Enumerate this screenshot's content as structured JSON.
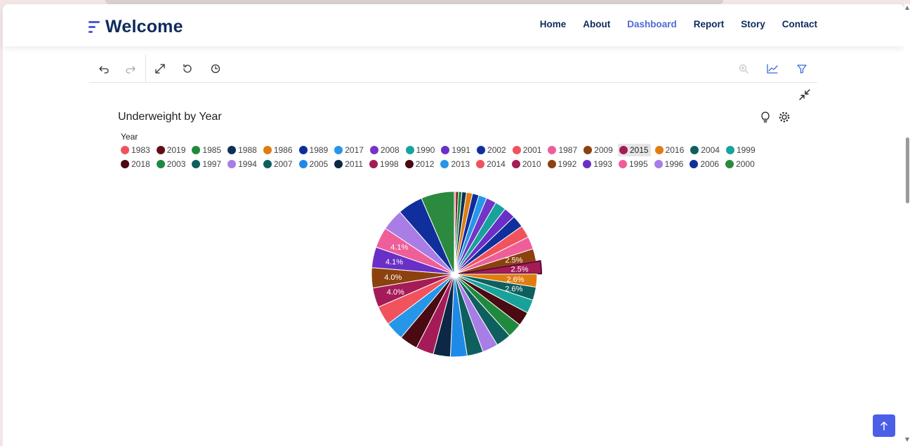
{
  "nav": {
    "brand": "Welcome",
    "links": [
      "Home",
      "About",
      "Dashboard",
      "Report",
      "Story",
      "Contact"
    ],
    "active": "Dashboard"
  },
  "toolbar": {
    "left_icons": [
      "undo-icon",
      "redo-icon",
      "expand-icon",
      "reset-icon",
      "history-icon"
    ],
    "right_icons": [
      "zoom-icon",
      "line-chart-icon",
      "filter-icon"
    ]
  },
  "chart": {
    "title": "Underweight by Year",
    "legend_title": "Year",
    "icons": [
      "lightbulb-icon",
      "settings-icon"
    ]
  },
  "colors": {
    "accent": "#4f6ad4",
    "brand": "#0f2a5c",
    "scroll_top_button": "#4b5ee8"
  },
  "chart_data": {
    "type": "pie",
    "title": "Underweight by Year",
    "legend_title": "Year",
    "highlighted": "2015",
    "categories": [
      "1983",
      "2019",
      "1985",
      "1988",
      "1986",
      "1989",
      "2017",
      "2008",
      "1990",
      "1991",
      "2002",
      "2001",
      "1987",
      "2009",
      "2015",
      "2016",
      "2004",
      "1999",
      "2018",
      "2003",
      "1997",
      "1994",
      "2007",
      "2005",
      "2011",
      "1998",
      "2012",
      "2013",
      "2014",
      "2010",
      "1992",
      "1993",
      "1995",
      "1996",
      "2006",
      "2000"
    ],
    "colors": [
      "#f0535d",
      "#5e1018",
      "#1f8a3e",
      "#0f2f57",
      "#e07d10",
      "#0f2d9c",
      "#2596e8",
      "#7136c8",
      "#17a39b",
      "#6a2fc6",
      "#102f9c",
      "#f0535d",
      "#ee5f99",
      "#8c420e",
      "#a51b58",
      "#e07d10",
      "#0f5f5f",
      "#17a39b",
      "#4a0a12",
      "#1f8a3e",
      "#0f5f5f",
      "#a97de6",
      "#0f5f5f",
      "#1f8ae6",
      "#0d2845",
      "#a51b58",
      "#4a0a12",
      "#2596e8",
      "#f0535d",
      "#a51b58",
      "#8c420e",
      "#6a2fc6",
      "#ee5f99",
      "#a97de6",
      "#102f9c",
      "#2b8a3e"
    ],
    "values": [
      0.3,
      0.5,
      0.7,
      0.9,
      1.2,
      1.3,
      1.6,
      2.0,
      2.2,
      2.3,
      2.4,
      2.45,
      2.5,
      2.5,
      2.5,
      2.6,
      2.6,
      2.7,
      2.8,
      2.9,
      3.0,
      3.1,
      3.2,
      3.3,
      3.4,
      3.5,
      3.6,
      3.7,
      3.8,
      3.9,
      4.0,
      4.1,
      4.1,
      4.3,
      5.0,
      6.6
    ],
    "labels": {
      "2009": "2.5%",
      "2015": "2.5%",
      "2016": "2.6%",
      "2004": "2.6%",
      "1992": "4.0%",
      "2010": "4.0%",
      "1993": "4.1%",
      "1995": "4.1%"
    }
  }
}
